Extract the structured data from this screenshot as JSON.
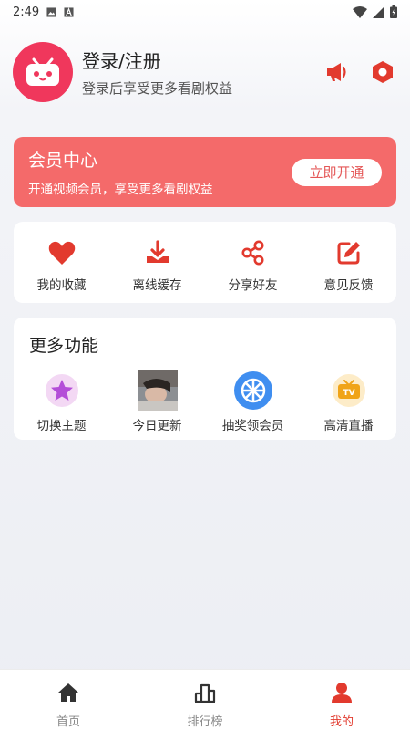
{
  "status_bar": {
    "time": "2:49",
    "icons": [
      "image-icon",
      "a-icon",
      "wifi-icon",
      "signal-icon",
      "battery-icon"
    ]
  },
  "header": {
    "login_title": "登录/注册",
    "login_subtitle": "登录后享受更多看剧权益",
    "actions": [
      "megaphone-icon",
      "settings-hexagon-icon"
    ]
  },
  "vip": {
    "title": "会员中心",
    "subtitle": "开通视频会员，享受更多看剧权益",
    "button_label": "立即开通"
  },
  "quick_actions": [
    {
      "label": "我的收藏",
      "icon": "heart-icon"
    },
    {
      "label": "离线缓存",
      "icon": "download-icon"
    },
    {
      "label": "分享好友",
      "icon": "share-icon"
    },
    {
      "label": "意见反馈",
      "icon": "edit-icon"
    }
  ],
  "more_features": {
    "title": "更多功能",
    "items": [
      {
        "label": "切换主题",
        "icon": "theme-star-icon"
      },
      {
        "label": "今日更新",
        "icon": "thumbnail-photo"
      },
      {
        "label": "抽奖领会员",
        "icon": "lottery-wheel-icon"
      },
      {
        "label": "高清直播",
        "icon": "tv-icon"
      }
    ]
  },
  "bottom_nav": [
    {
      "label": "首页",
      "icon": "home-icon",
      "active": false
    },
    {
      "label": "排行榜",
      "icon": "ranking-icon",
      "active": false
    },
    {
      "label": "我的",
      "icon": "profile-icon",
      "active": true
    }
  ],
  "colors": {
    "accent": "#e23a2e",
    "vip_banner": "#f46a6a",
    "avatar": "#f0375c"
  }
}
